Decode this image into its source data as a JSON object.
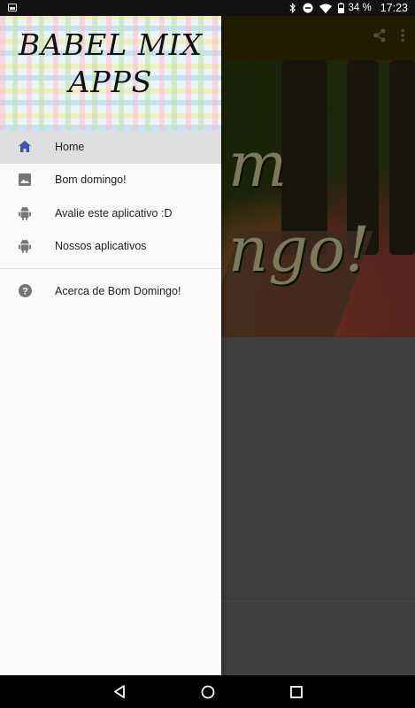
{
  "status_bar": {
    "battery_percent": "34 %",
    "time": "17:23",
    "icons": [
      "image-icon",
      "bluetooth-icon",
      "do-not-disturb-icon",
      "wifi-icon",
      "battery-icon"
    ]
  },
  "app_bar": {
    "actions": [
      "share-icon",
      "overflow-menu-icon"
    ]
  },
  "hero": {
    "text_line1": "m",
    "text_line2": "ngo!"
  },
  "drawer": {
    "header_title_line1": "BABEL MIX",
    "header_title_line2": "APPS",
    "items": [
      {
        "label": "Home",
        "icon": "home-icon",
        "active": true
      },
      {
        "label": "Bom domingo!",
        "icon": "image-icon",
        "active": false
      },
      {
        "label": "Avalie este aplicativo :D",
        "icon": "android-icon",
        "active": false
      },
      {
        "label": "Nossos aplicativos",
        "icon": "android-icon",
        "active": false
      }
    ],
    "secondary_items": [
      {
        "label": "Acerca de Bom Domingo!",
        "icon": "help-icon"
      }
    ]
  },
  "colors": {
    "accent_active_icon": "#3f51b5",
    "icon_gray": "#757575",
    "app_bar_dimmed": "#3b3204"
  },
  "nav_bar": {
    "buttons": [
      "back-icon",
      "home-circle-icon",
      "recents-icon"
    ]
  }
}
